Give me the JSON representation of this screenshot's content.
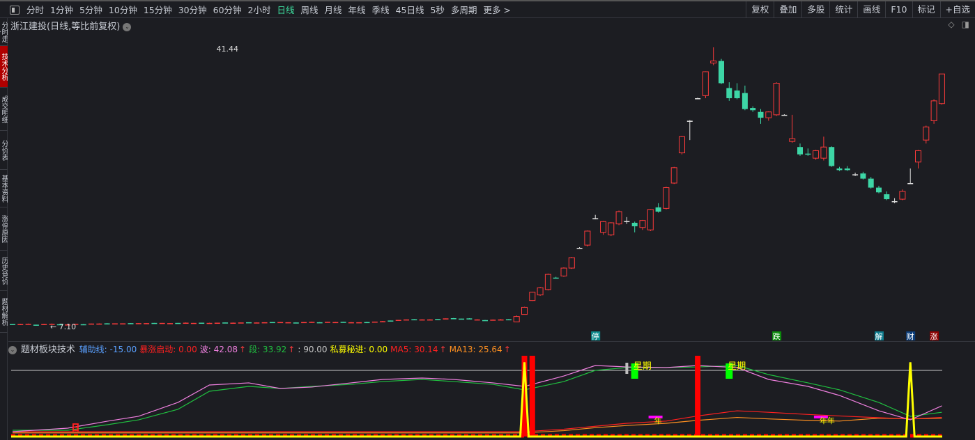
{
  "toolbar": {
    "periods": [
      "分时",
      "1分钟",
      "5分钟",
      "10分钟",
      "15分钟",
      "30分钟",
      "60分钟",
      "2小时",
      "日线",
      "周线",
      "月线",
      "年线",
      "季线",
      "45日线",
      "5秒",
      "多周期",
      "更多 >"
    ],
    "active": "日线",
    "right_buttons": [
      "复权",
      "叠加",
      "多股",
      "统计",
      "画线",
      "F10",
      "标记",
      "+自选"
    ]
  },
  "side_tabs": [
    "分时走势",
    "技术分析",
    "成交明细",
    "分价表",
    "基本资料",
    "涨停原因",
    "历史竞价",
    "题材解析"
  ],
  "side_active": 1,
  "chart": {
    "title": "浙江建投(日线,等比前复权)",
    "high_label": "41.44",
    "low_label": "7.10",
    "colors": {
      "up": "#ff3b3b",
      "down": "#3dd6a6",
      "doji": "#e0e0e0"
    },
    "scale": "log",
    "ohlc": [
      [
        7.15,
        7.15,
        7.12,
        7.12
      ],
      [
        7.14,
        7.16,
        7.14,
        7.15
      ],
      [
        7.15,
        7.17,
        7.15,
        7.16
      ],
      [
        7.12,
        7.12,
        7.08,
        7.1
      ],
      [
        7.14,
        7.16,
        7.13,
        7.15
      ],
      [
        7.16,
        7.17,
        7.15,
        7.16
      ],
      [
        7.14,
        7.14,
        7.11,
        7.12
      ],
      [
        7.12,
        7.14,
        7.12,
        7.13
      ],
      [
        7.15,
        7.16,
        7.15,
        7.16
      ],
      [
        7.13,
        7.15,
        7.13,
        7.14
      ],
      [
        7.16,
        7.17,
        7.16,
        7.17
      ],
      [
        7.16,
        7.18,
        7.16,
        7.17
      ],
      [
        7.18,
        7.19,
        7.17,
        7.18
      ],
      [
        7.18,
        7.18,
        7.17,
        7.17
      ],
      [
        7.17,
        7.18,
        7.17,
        7.18
      ],
      [
        7.18,
        7.19,
        7.18,
        7.19
      ],
      [
        7.19,
        7.19,
        7.17,
        7.18
      ],
      [
        7.18,
        7.19,
        7.18,
        7.19
      ],
      [
        7.19,
        7.2,
        7.19,
        7.2
      ],
      [
        7.2,
        7.2,
        7.18,
        7.18
      ],
      [
        7.18,
        7.19,
        7.18,
        7.19
      ],
      [
        7.19,
        7.2,
        7.19,
        7.2
      ],
      [
        7.21,
        7.22,
        7.18,
        7.19
      ],
      [
        7.19,
        7.2,
        7.19,
        7.2
      ],
      [
        7.2,
        7.21,
        7.2,
        7.21
      ],
      [
        7.2,
        7.21,
        7.2,
        7.2
      ],
      [
        7.2,
        7.21,
        7.2,
        7.21
      ],
      [
        7.21,
        7.22,
        7.21,
        7.22
      ],
      [
        7.21,
        7.22,
        7.21,
        7.21
      ],
      [
        7.21,
        7.22,
        7.21,
        7.22
      ],
      [
        7.22,
        7.23,
        7.22,
        7.23
      ],
      [
        7.22,
        7.23,
        7.22,
        7.22
      ],
      [
        7.22,
        7.23,
        7.22,
        7.23
      ],
      [
        7.23,
        7.24,
        7.23,
        7.24
      ],
      [
        7.24,
        7.24,
        7.22,
        7.22
      ],
      [
        7.22,
        7.23,
        7.22,
        7.23
      ],
      [
        7.22,
        7.23,
        7.22,
        7.22
      ],
      [
        7.23,
        7.24,
        7.23,
        7.24
      ],
      [
        7.25,
        7.26,
        7.23,
        7.24
      ],
      [
        7.23,
        7.24,
        7.23,
        7.23
      ],
      [
        7.24,
        7.25,
        7.24,
        7.25
      ],
      [
        7.24,
        7.25,
        7.24,
        7.24
      ],
      [
        7.24,
        7.25,
        7.24,
        7.25
      ],
      [
        7.23,
        7.24,
        7.22,
        7.22
      ],
      [
        7.22,
        7.23,
        7.22,
        7.23
      ],
      [
        7.23,
        7.25,
        7.23,
        7.24
      ],
      [
        7.24,
        7.26,
        7.24,
        7.26
      ],
      [
        7.27,
        7.29,
        7.27,
        7.28
      ],
      [
        7.29,
        7.31,
        7.29,
        7.31
      ],
      [
        7.32,
        7.34,
        7.32,
        7.34
      ],
      [
        7.34,
        7.36,
        7.34,
        7.36
      ],
      [
        7.37,
        7.38,
        7.36,
        7.37
      ],
      [
        7.36,
        7.37,
        7.34,
        7.35
      ],
      [
        7.36,
        7.37,
        7.35,
        7.36
      ],
      [
        7.36,
        7.38,
        7.36,
        7.38
      ],
      [
        7.39,
        7.41,
        7.39,
        7.41
      ],
      [
        7.42,
        7.43,
        7.38,
        7.39
      ],
      [
        7.38,
        7.4,
        7.38,
        7.4
      ],
      [
        7.41,
        7.42,
        7.37,
        7.38
      ],
      [
        7.36,
        7.37,
        7.33,
        7.34
      ],
      [
        7.33,
        7.34,
        7.31,
        7.32
      ],
      [
        7.33,
        7.36,
        7.33,
        7.35
      ],
      [
        7.36,
        7.38,
        7.33,
        7.34
      ],
      [
        7.35,
        7.38,
        7.35,
        7.37
      ],
      [
        7.25,
        7.55,
        7.25,
        7.5
      ],
      [
        7.6,
        7.98,
        7.6,
        7.95
      ],
      [
        8.3,
        8.78,
        8.28,
        8.75
      ],
      [
        8.6,
        9.05,
        8.55,
        9.0
      ],
      [
        8.9,
        9.85,
        8.85,
        9.8
      ],
      [
        9.58,
        9.65,
        9.55,
        9.6
      ],
      [
        9.7,
        10.25,
        9.65,
        10.2
      ],
      [
        10.2,
        10.95,
        10.15,
        10.9
      ],
      [
        11.6,
        11.65,
        11.55,
        11.6
      ],
      [
        11.8,
        12.95,
        11.7,
        12.9
      ],
      [
        13.95,
        14.3,
        13.9,
        14.0
      ],
      [
        12.8,
        13.75,
        12.6,
        13.7
      ],
      [
        12.6,
        13.65,
        12.5,
        13.6
      ],
      [
        13.5,
        14.7,
        13.4,
        14.6
      ],
      [
        13.75,
        14.1,
        13.5,
        13.7
      ],
      [
        13.6,
        13.7,
        12.8,
        13.3
      ],
      [
        13.2,
        13.85,
        13.0,
        13.8
      ],
      [
        13.0,
        14.85,
        12.9,
        14.8
      ],
      [
        15.0,
        15.4,
        14.5,
        14.6
      ],
      [
        14.9,
        17.1,
        14.8,
        17.0
      ],
      [
        17.5,
        19.4,
        17.4,
        19.3
      ],
      [
        21.2,
        23.6,
        21.0,
        23.5
      ],
      [
        26.0,
        26.1,
        23.0,
        26.0
      ],
      [
        30.0,
        30.1,
        29.9,
        30.0
      ],
      [
        30.5,
        35.6,
        30.0,
        35.5
      ],
      [
        37.5,
        41.44,
        37.0,
        38.0
      ],
      [
        38.0,
        38.5,
        32.8,
        33.0
      ],
      [
        32.0,
        33.2,
        29.5,
        30.0
      ],
      [
        31.5,
        33.0,
        29.8,
        30.0
      ],
      [
        31.0,
        32.5,
        27.8,
        28.0
      ],
      [
        28.2,
        28.5,
        27.5,
        27.8
      ],
      [
        27.5,
        28.0,
        25.5,
        26.5
      ],
      [
        26.5,
        27.6,
        26.0,
        27.5
      ],
      [
        27.0,
        33.2,
        26.8,
        33.0
      ],
      [
        27.0,
        27.1,
        26.9,
        27.0
      ],
      [
        22.8,
        27.0,
        22.6,
        23.2
      ],
      [
        22.0,
        22.5,
        20.8,
        21.0
      ],
      [
        21.1,
        21.8,
        20.8,
        21.0
      ],
      [
        20.5,
        21.6,
        20.3,
        21.5
      ],
      [
        20.5,
        23.5,
        20.2,
        22.0
      ],
      [
        22.0,
        22.1,
        19.4,
        19.5
      ],
      [
        19.2,
        19.4,
        18.9,
        19.0
      ],
      [
        19.2,
        19.5,
        18.9,
        19.0
      ],
      [
        18.5,
        18.7,
        18.3,
        18.5
      ],
      [
        18.6,
        18.8,
        17.9,
        18.0
      ],
      [
        18.0,
        18.2,
        16.9,
        17.0
      ],
      [
        17.0,
        17.2,
        16.4,
        16.5
      ],
      [
        16.3,
        16.6,
        15.7,
        15.8
      ],
      [
        15.6,
        15.9,
        15.4,
        15.6
      ],
      [
        15.8,
        16.8,
        15.7,
        16.6
      ],
      [
        17.5,
        19.2,
        17.4,
        17.5
      ],
      [
        20.0,
        21.6,
        19.2,
        21.5
      ],
      [
        23.0,
        25.2,
        22.5,
        25.0
      ],
      [
        26.0,
        29.8,
        25.5,
        29.5
      ],
      [
        29.0,
        35.0,
        28.8,
        35.0
      ]
    ],
    "events": [
      {
        "label": "停",
        "bar": 74,
        "color": "#0b8a8c"
      },
      {
        "label": "跌",
        "bar": 97,
        "color": "#0b8a0b"
      },
      {
        "label": "解",
        "bar": 110,
        "color": "#0b7a8c"
      },
      {
        "label": "财",
        "bar": 114,
        "color": "#0b3d7a"
      },
      {
        "label": "涨",
        "bar": 117,
        "color": "#8a0000"
      }
    ]
  },
  "indicator": {
    "name": "题材板块技术",
    "values": [
      {
        "label": "辅助线: -15.00",
        "color": "#5aa0ff"
      },
      {
        "label": "暴涨启动: 0.00",
        "color": "#ff2020"
      },
      {
        "label": "波: 42.08",
        "color": "#f080e0",
        "arrow": true
      },
      {
        "label": "段: 33.92",
        "color": "#20c040",
        "arrow": true
      },
      {
        "label": ": 90.00",
        "color": "#c8c8c8"
      },
      {
        "label": "私募秘进: 0.00",
        "color": "#ffff00"
      },
      {
        "label": "MA5: 30.14",
        "color": "#ff2020",
        "arrow": true
      },
      {
        "label": "MA13: 25.64",
        "color": "#ff9020",
        "arrow": true
      }
    ],
    "sample_bars": [
      0,
      7,
      12,
      16,
      21,
      25,
      30,
      34,
      38,
      43,
      47,
      52,
      56,
      61,
      65,
      70,
      74,
      78,
      83,
      87,
      92,
      96,
      101,
      105,
      110,
      114,
      118
    ],
    "wave": [
      6.6,
      11.4,
      20.8,
      27.5,
      46.4,
      70.1,
      73,
      65.4,
      67.3,
      73,
      77.7,
      79.6,
      77.7,
      73,
      68.2,
      82.4,
      96.6,
      94.7,
      93.8,
      96.6,
      93.8,
      77.7,
      68.2,
      55.9,
      35,
      22.7,
      41.7
    ],
    "segment": [
      8.5,
      8.5,
      16,
      22.7,
      37,
      61.6,
      68.2,
      65.4,
      68.2,
      71,
      74.8,
      77.7,
      74.8,
      71,
      63.5,
      74.8,
      90,
      93.8,
      93.8,
      94.7,
      96.6,
      84.3,
      73,
      63.5,
      46.4,
      27.5,
      33
    ],
    "ma5": [
      6.6,
      6.6,
      6.6,
      6.6,
      6.6,
      6.6,
      6.6,
      6.6,
      6.6,
      6.6,
      6.6,
      6.6,
      6.6,
      6.6,
      6.6,
      10,
      14,
      18,
      21,
      28,
      35,
      33,
      30,
      28,
      25.6,
      24,
      26
    ],
    "ma13": [
      5,
      5,
      5,
      5,
      5,
      5,
      5,
      5,
      5,
      5,
      5,
      5,
      5,
      5,
      5,
      8,
      12,
      15,
      18,
      22,
      26,
      24,
      22,
      21,
      25,
      24,
      25
    ],
    "line_level": 90,
    "spikes": [
      65,
      114
    ],
    "red_bars": [
      65,
      66,
      87
    ],
    "grey_bar": 78,
    "week_marks": [
      {
        "label": "星期",
        "bar": 79
      },
      {
        "label": "星期",
        "bar": 91
      }
    ],
    "day_mark": {
      "label": "日",
      "bar": 8
    },
    "year_marks": [
      {
        "label": "年",
        "bar": 82
      },
      {
        "label": "年年",
        "bar": 103
      }
    ]
  }
}
